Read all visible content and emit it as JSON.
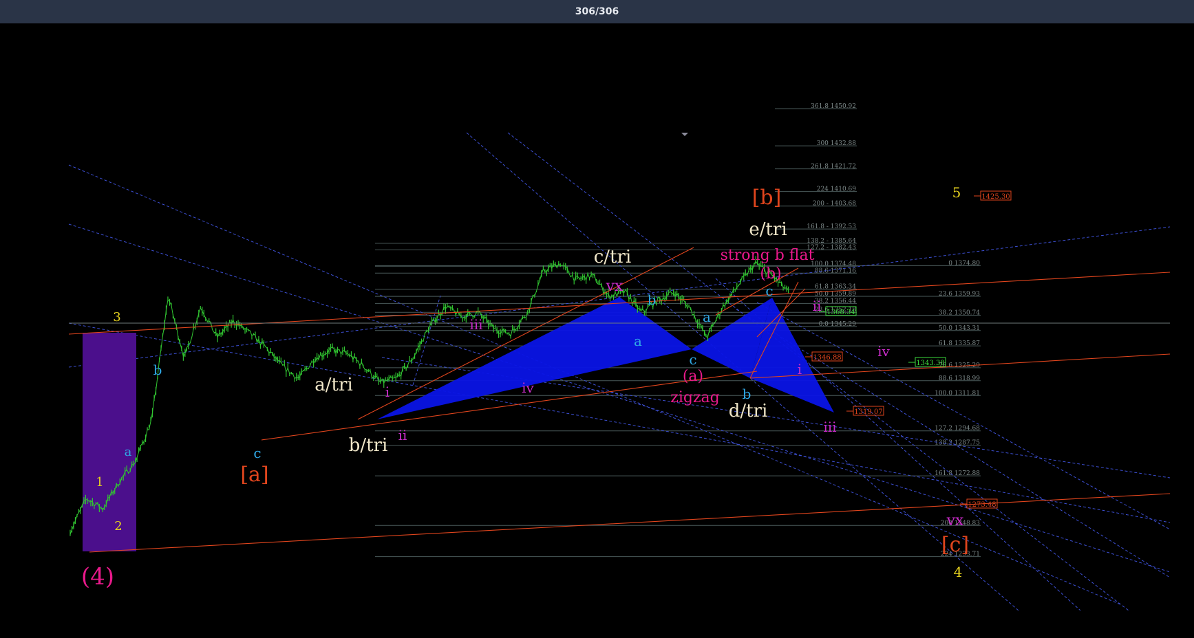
{
  "viewer": {
    "counter": "306/306",
    "background": "#2a3447"
  },
  "chart_data": {
    "type": "line",
    "title": "",
    "description_note": "",
    "candles_color": "#31c531",
    "background": "#000000",
    "price_waypoints": [
      1246,
      1262,
      1257,
      1270,
      1280,
      1300,
      1360,
      1330,
      1355,
      1340,
      1348,
      1342,
      1335,
      1326,
      1320,
      1330,
      1334,
      1332,
      1326,
      1318,
      1320,
      1330,
      1345,
      1355,
      1350,
      1352,
      1344,
      1342,
      1352,
      1372,
      1376,
      1368,
      1370,
      1360,
      1362,
      1352,
      1358,
      1362,
      1354,
      1340,
      1355,
      1366,
      1376,
      1370,
      1362
    ],
    "fib_levels_left": [
      {
        "label": "361.8 1450.92",
        "price": 1450.92
      },
      {
        "label": "300 1432.88",
        "price": 1432.88
      },
      {
        "label": "261.8 1421.72",
        "price": 1421.72
      },
      {
        "label": "224 1410.69",
        "price": 1410.69
      },
      {
        "label": "200 - 1403.68",
        "price": 1403.68
      },
      {
        "label": "161.8 - 1392.53",
        "price": 1392.53
      },
      {
        "label": "138.2 - 1385.64",
        "price": 1385.64
      },
      {
        "label": "127.2 - 1382.43",
        "price": 1382.43
      },
      {
        "label": "100.0 1374.48",
        "price": 1374.48
      },
      {
        "label": "88.6 1371.16",
        "price": 1371.16
      },
      {
        "label": "61.8 1363.34",
        "price": 1363.34
      },
      {
        "label": "50.0 1359.89",
        "price": 1359.89
      },
      {
        "label": "38.2 1356.44",
        "price": 1356.44
      },
      {
        "label": "23.6 1352.18",
        "price": 1352.18
      },
      {
        "label": "0.0 1345.29",
        "price": 1345.29
      }
    ],
    "fib_levels_right": [
      {
        "label": "0 1374.80",
        "price": 1374.8
      },
      {
        "label": "23.6 1359.93",
        "price": 1359.93
      },
      {
        "label": "38.2 1350.74",
        "price": 1350.74
      },
      {
        "label": "50.0 1343.31",
        "price": 1343.31
      },
      {
        "label": "61.8 1335.87",
        "price": 1335.87
      },
      {
        "label": "78.6 1325.29",
        "price": 1325.29
      },
      {
        "label": "88.6 1318.99",
        "price": 1318.99
      },
      {
        "label": "100.0 1311.81",
        "price": 1311.81
      },
      {
        "label": "127.2 1294.68",
        "price": 1294.68
      },
      {
        "label": "138.2 1287.75",
        "price": 1287.75
      },
      {
        "label": "161.8 1272.88",
        "price": 1272.88
      },
      {
        "label": "200 1248.83",
        "price": 1248.83
      },
      {
        "label": "224 1233.71",
        "price": 1233.71
      }
    ],
    "price_tags": [
      {
        "text": "1425.30",
        "price": 1425.3,
        "color": "#e0451d"
      },
      {
        "text": "1368.34",
        "price": 1368.34,
        "color": "#3ddc3d"
      },
      {
        "text": "1346.88",
        "price": 1346.88,
        "color": "#e0451d"
      },
      {
        "text": "1343.38",
        "price": 1343.38,
        "color": "#3ddc3d"
      },
      {
        "text": "1319.07",
        "price": 1319.07,
        "color": "#e0451d"
      },
      {
        "text": "1273.48",
        "price": 1273.48,
        "color": "#e0451d"
      }
    ],
    "wave_labels": [
      {
        "text": "3",
        "color": "#e6d21f"
      },
      {
        "text": "1",
        "color": "#e6d21f"
      },
      {
        "text": "2",
        "color": "#e6d21f"
      },
      {
        "text": "b",
        "color": "#2fa8e6"
      },
      {
        "text": "a",
        "color": "#2fa8e6"
      },
      {
        "text": "c",
        "color": "#2fa8e6"
      },
      {
        "text": "[a]",
        "color": "#e0451d"
      },
      {
        "text": "(4)",
        "color": "#e8198a"
      },
      {
        "text": "a/tri",
        "color": "#f0e6c8"
      },
      {
        "text": "b/tri",
        "color": "#f0e6c8"
      },
      {
        "text": "i",
        "color": "#c82cc8"
      },
      {
        "text": "ii",
        "color": "#c82cc8"
      },
      {
        "text": "iii",
        "color": "#c82cc8"
      },
      {
        "text": "iv",
        "color": "#c82cc8"
      },
      {
        "text": "c/tri",
        "color": "#f0e6c8"
      },
      {
        "text": "vx",
        "color": "#c82cc8"
      },
      {
        "text": "b",
        "color": "#2fa8e6"
      },
      {
        "text": "a",
        "color": "#2fa8e6"
      },
      {
        "text": "a",
        "color": "#2fa8e6"
      },
      {
        "text": "c",
        "color": "#2fa8e6"
      },
      {
        "text": "(a)",
        "color": "#e8198a"
      },
      {
        "text": "zigzag",
        "color": "#e8198a"
      },
      {
        "text": "b",
        "color": "#2fa8e6"
      },
      {
        "text": "d/tri",
        "color": "#f0e6c8"
      },
      {
        "text": "c",
        "color": "#2fa8e6"
      },
      {
        "text": "(b)",
        "color": "#e8198a"
      },
      {
        "text": "strong b flat",
        "color": "#e8198a"
      },
      {
        "text": "e/tri",
        "color": "#f0e6c8"
      },
      {
        "text": "[b]",
        "color": "#e0451d"
      },
      {
        "text": "ii",
        "color": "#c82cc8"
      },
      {
        "text": "i",
        "color": "#c82cc8"
      },
      {
        "text": "iii",
        "color": "#c82cc8"
      },
      {
        "text": "iv",
        "color": "#c82cc8"
      },
      {
        "text": "5",
        "color": "#e6d21f"
      },
      {
        "text": "vx",
        "color": "#c82cc8"
      },
      {
        "text": "[c]",
        "color": "#e0451d"
      },
      {
        "text": "4",
        "color": "#e6d21f"
      }
    ],
    "colors": {
      "trendline": "#e0451d",
      "channel_dashed": "#3c4fd2",
      "pattern_fill": "#0a14e6",
      "highlight_box": "#4b0f8c",
      "fib_line": "#4a5a5a",
      "fib_text": "#7e8a8a"
    },
    "grid": false
  }
}
